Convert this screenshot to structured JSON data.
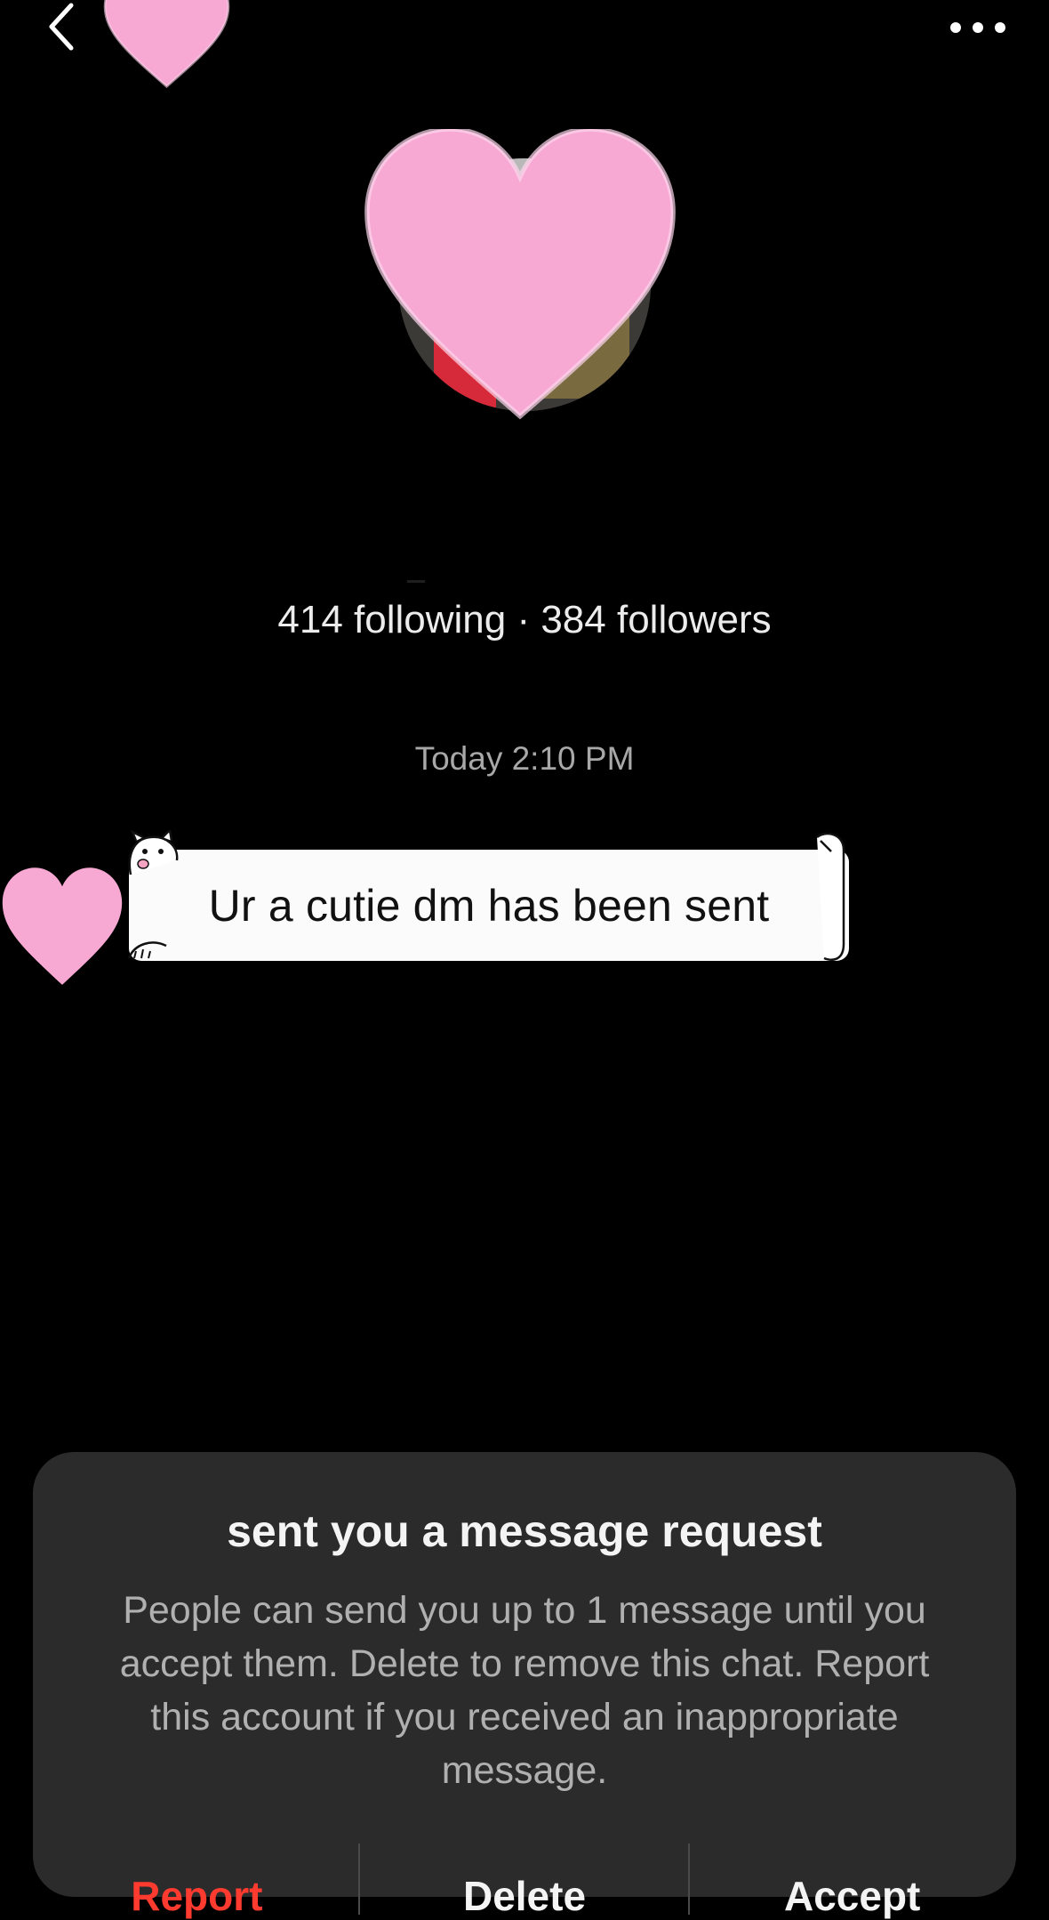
{
  "header": {
    "back_icon": "chevron-left-icon",
    "more_icon": "more-horizontal-icon"
  },
  "profile": {
    "following_count": "414",
    "followers_count": "384",
    "stats_text": "414 following · 384 followers"
  },
  "conversation": {
    "timestamp": "Today 2:10 PM",
    "messages": [
      {
        "text": "Ur a cutie dm has been sent"
      }
    ]
  },
  "request_panel": {
    "title": "sent you a message request",
    "body": "People can send you up to 1 message until you accept them. Delete to remove this chat. Report this account if you received an inappropriate message.",
    "actions": {
      "report": "Report",
      "delete": "Delete",
      "accept": "Accept"
    }
  },
  "colors": {
    "background": "#000000",
    "panel": "#2b2b2b",
    "heart_pink": "#f7a9d4",
    "report_red": "#ff3b30",
    "bubble": "#fbfbfb"
  }
}
